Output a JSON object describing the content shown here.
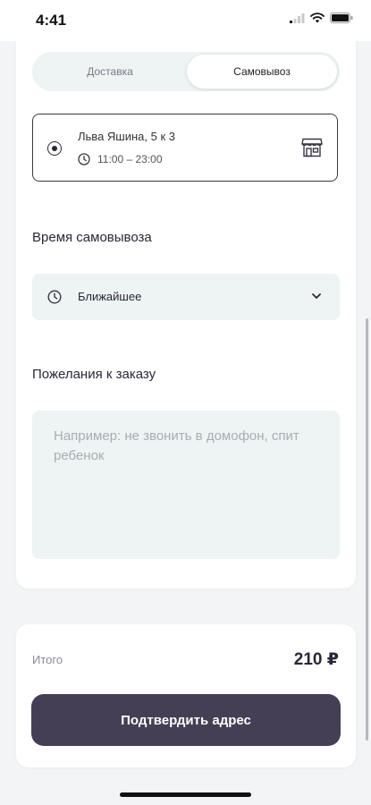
{
  "status_bar": {
    "time": "4:41"
  },
  "tabs": {
    "delivery": "Доставка",
    "pickup": "Самовывоз",
    "selected": "pickup"
  },
  "pickup_point": {
    "address": "Льва Яшина, 5 к 3",
    "hours": "11:00 – 23:00",
    "icon": "store-icon"
  },
  "pickup_time": {
    "title": "Время самовывоза",
    "value": "Ближайшее"
  },
  "wishes": {
    "title": "Пожелания к заказу",
    "placeholder": "Например: не звонить в домофон, спит ребенок",
    "value": ""
  },
  "summary": {
    "total_label": "Итого",
    "total_value": "210 ₽"
  },
  "confirm_button": {
    "label": "Подтвердить адрес"
  },
  "colors": {
    "accent": "#453f55",
    "field_bg": "#eef3f3",
    "text": "#2a2638"
  }
}
